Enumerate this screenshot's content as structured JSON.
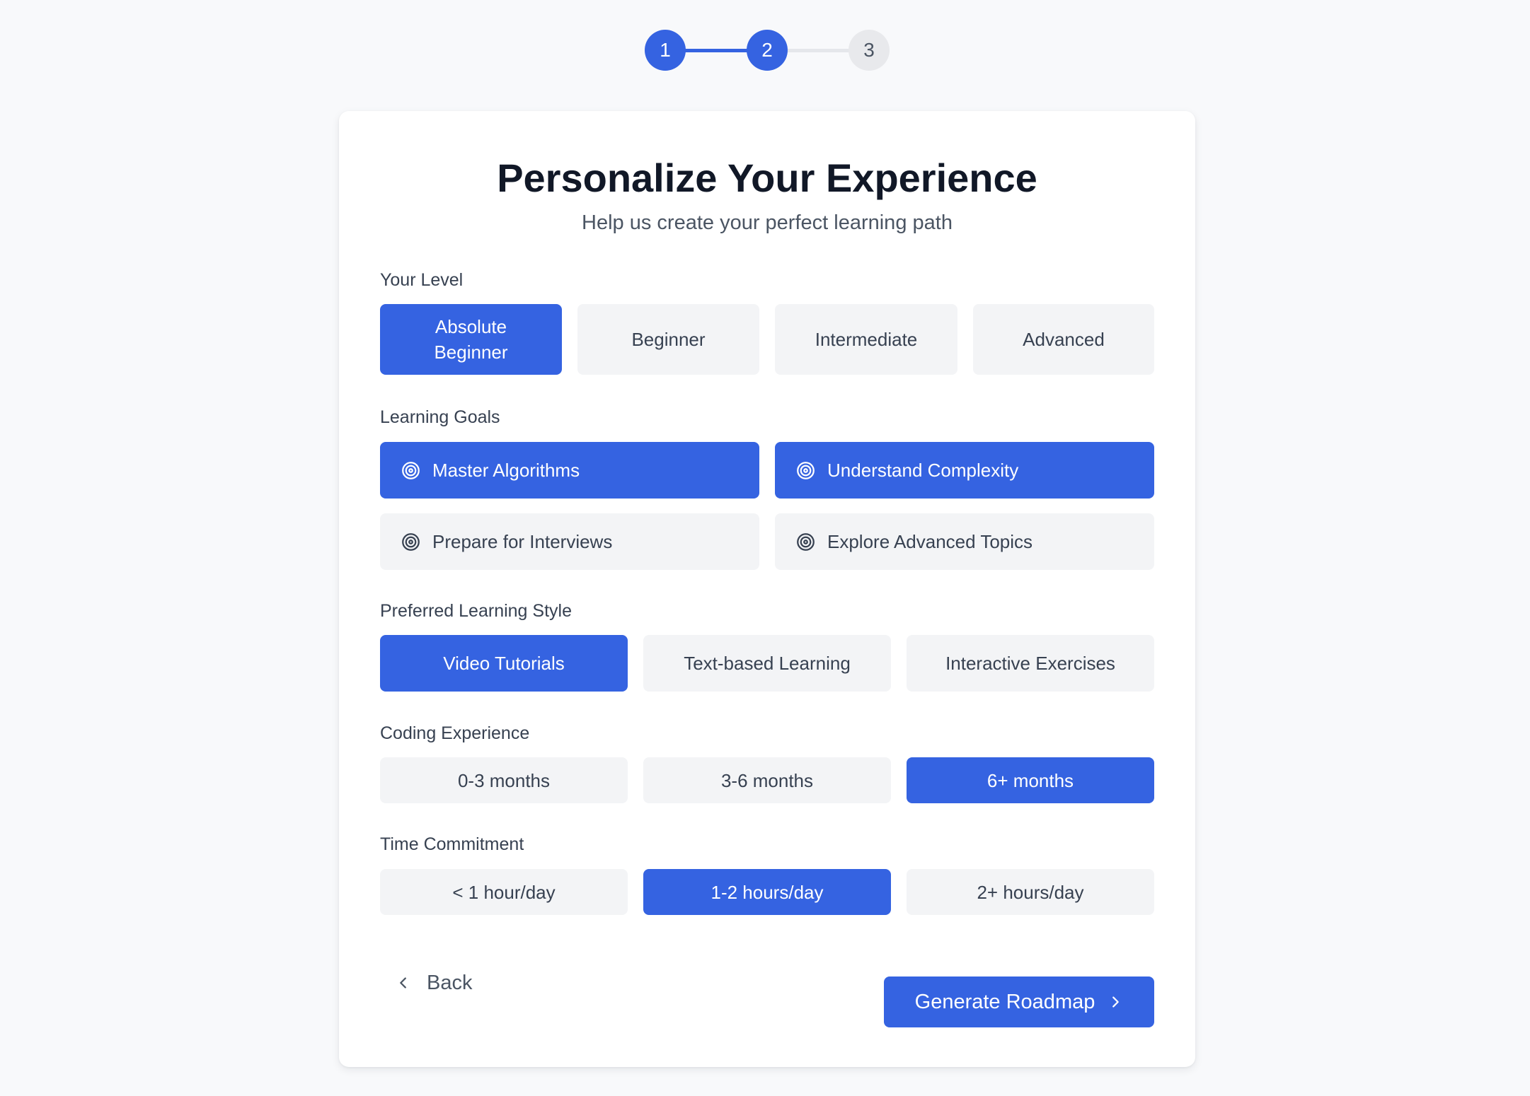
{
  "stepper": {
    "steps": [
      {
        "label": "1",
        "state": "completed"
      },
      {
        "label": "2",
        "state": "current"
      },
      {
        "label": "3",
        "state": "upcoming"
      }
    ]
  },
  "header": {
    "title": "Personalize Your Experience",
    "subtitle": "Help us create your perfect learning path"
  },
  "level": {
    "label": "Your Level",
    "options": [
      {
        "label": "Absolute Beginner",
        "selected": true
      },
      {
        "label": "Beginner",
        "selected": false
      },
      {
        "label": "Intermediate",
        "selected": false
      },
      {
        "label": "Advanced",
        "selected": false
      }
    ]
  },
  "goals": {
    "label": "Learning Goals",
    "icon": "target-icon",
    "options": [
      {
        "label": "Master Algorithms",
        "selected": true
      },
      {
        "label": "Understand Complexity",
        "selected": true
      },
      {
        "label": "Prepare for Interviews",
        "selected": false
      },
      {
        "label": "Explore Advanced Topics",
        "selected": false
      }
    ]
  },
  "style": {
    "label": "Preferred Learning Style",
    "options": [
      {
        "label": "Video Tutorials",
        "selected": true
      },
      {
        "label": "Text-based Learning",
        "selected": false
      },
      {
        "label": "Interactive Exercises",
        "selected": false
      }
    ]
  },
  "experience": {
    "label": "Coding Experience",
    "options": [
      {
        "label": "0-3 months",
        "selected": false
      },
      {
        "label": "3-6 months",
        "selected": false
      },
      {
        "label": "6+ months",
        "selected": true
      }
    ]
  },
  "time": {
    "label": "Time Commitment",
    "options": [
      {
        "label": "< 1 hour/day",
        "selected": false
      },
      {
        "label": "1-2 hours/day",
        "selected": true
      },
      {
        "label": "2+ hours/day",
        "selected": false
      }
    ]
  },
  "footer": {
    "back_label": "Back",
    "back_icon": "chevron-left-icon",
    "generate_label": "Generate Roadmap",
    "generate_icon": "chevron-right-icon"
  },
  "colors": {
    "accent": "#3563e1",
    "option_bg": "#f3f4f6",
    "page_bg": "#f8f9fb"
  }
}
